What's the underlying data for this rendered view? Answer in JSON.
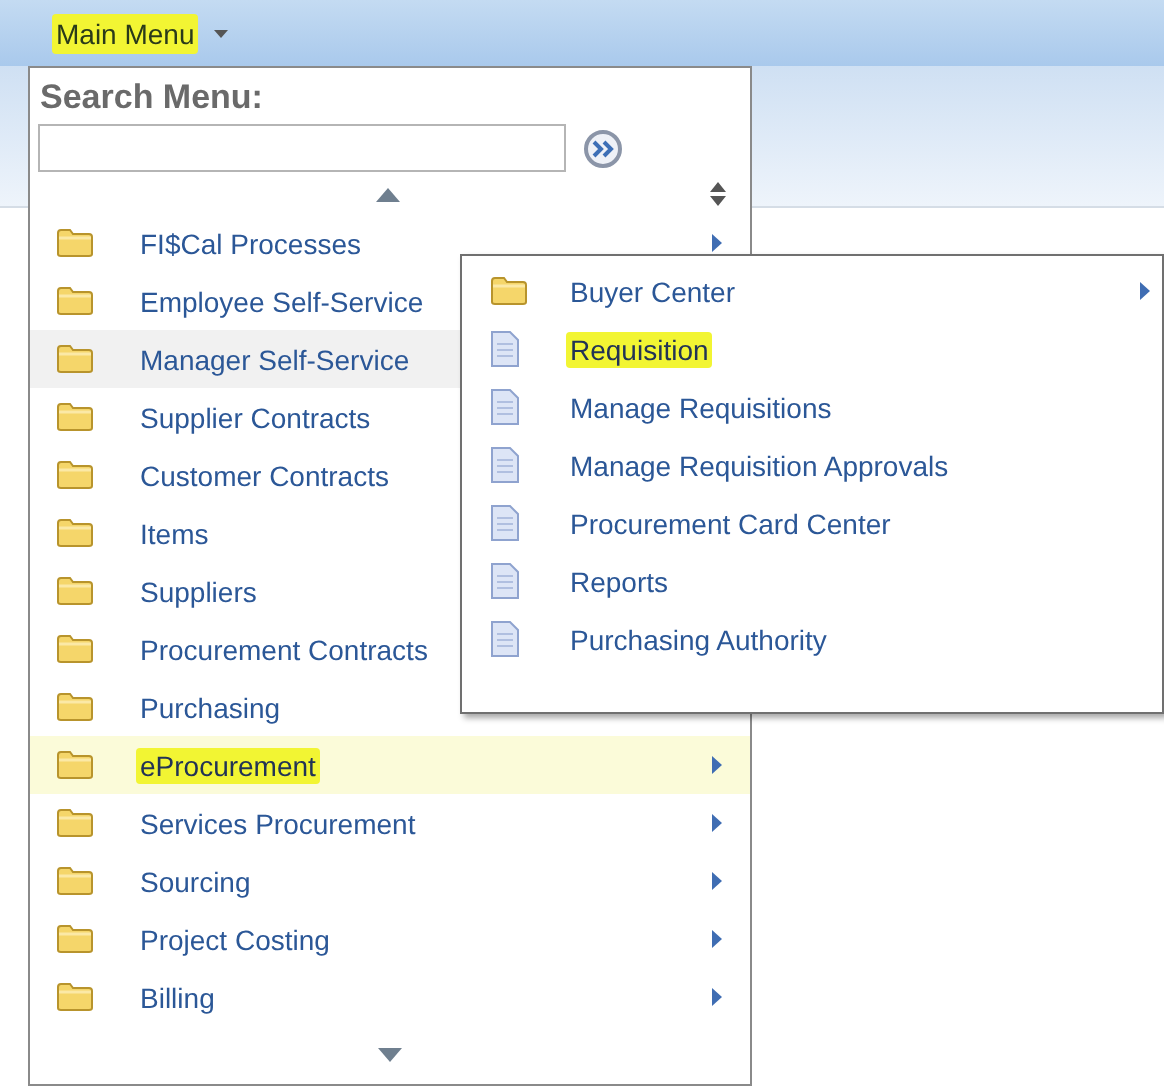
{
  "menu_button": {
    "label": "Main Menu",
    "marked": true
  },
  "search": {
    "label": "Search Menu:"
  },
  "menu_items": [
    {
      "label": "FI$Cal Processes",
      "selected": false,
      "hovered": false,
      "marked": false,
      "submenu": true
    },
    {
      "label": "Employee Self-Service",
      "selected": false,
      "hovered": false,
      "marked": false,
      "submenu": false
    },
    {
      "label": "Manager Self-Service",
      "selected": false,
      "hovered": true,
      "marked": false,
      "submenu": false
    },
    {
      "label": "Supplier Contracts",
      "selected": false,
      "hovered": false,
      "marked": false,
      "submenu": false
    },
    {
      "label": "Customer Contracts",
      "selected": false,
      "hovered": false,
      "marked": false,
      "submenu": false
    },
    {
      "label": "Items",
      "selected": false,
      "hovered": false,
      "marked": false,
      "submenu": false
    },
    {
      "label": "Suppliers",
      "selected": false,
      "hovered": false,
      "marked": false,
      "submenu": false
    },
    {
      "label": "Procurement Contracts",
      "selected": false,
      "hovered": false,
      "marked": false,
      "submenu": false
    },
    {
      "label": "Purchasing",
      "selected": false,
      "hovered": false,
      "marked": false,
      "submenu": false
    },
    {
      "label": "eProcurement",
      "selected": true,
      "hovered": false,
      "marked": true,
      "submenu": true
    },
    {
      "label": "Services Procurement",
      "selected": false,
      "hovered": false,
      "marked": false,
      "submenu": true
    },
    {
      "label": "Sourcing",
      "selected": false,
      "hovered": false,
      "marked": false,
      "submenu": true
    },
    {
      "label": "Project Costing",
      "selected": false,
      "hovered": false,
      "marked": false,
      "submenu": true
    },
    {
      "label": "Billing",
      "selected": false,
      "hovered": false,
      "marked": false,
      "submenu": true
    }
  ],
  "submenu_items": [
    {
      "label": "Buyer Center",
      "kind": "folder",
      "marked": false,
      "submenu": true
    },
    {
      "label": "Requisition",
      "kind": "page",
      "marked": true,
      "submenu": false
    },
    {
      "label": "Manage Requisitions",
      "kind": "page",
      "marked": false,
      "submenu": false
    },
    {
      "label": "Manage Requisition Approvals",
      "kind": "page",
      "marked": false,
      "submenu": false
    },
    {
      "label": "Procurement Card Center",
      "kind": "page",
      "marked": false,
      "submenu": false
    },
    {
      "label": "Reports",
      "kind": "page",
      "marked": false,
      "submenu": false
    },
    {
      "label": "Purchasing Authority",
      "kind": "page",
      "marked": false,
      "submenu": false
    }
  ]
}
